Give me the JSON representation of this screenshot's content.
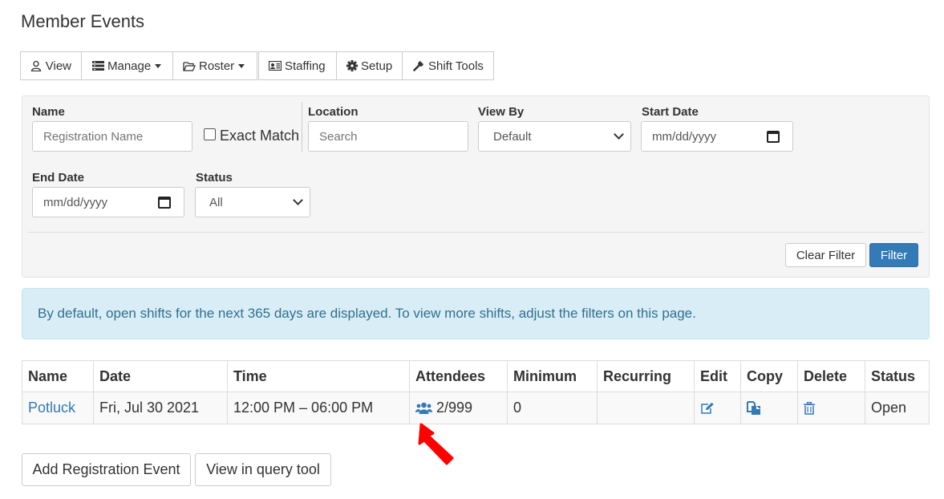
{
  "page": {
    "title": "Member Events"
  },
  "toolbar": {
    "view": "View",
    "manage": "Manage",
    "roster": "Roster",
    "staffing": "Staffing",
    "setup": "Setup",
    "shift_tools": "Shift Tools"
  },
  "filters": {
    "name_label": "Name",
    "name_placeholder": "Registration Name",
    "exact_match_label": "Exact Match",
    "location_label": "Location",
    "location_placeholder": "Search",
    "view_by_label": "View By",
    "view_by_value": "Default",
    "start_date_label": "Start Date",
    "start_date_value": "mm/dd/yyyy",
    "end_date_label": "End Date",
    "end_date_value": "mm/dd/yyyy",
    "status_label": "Status",
    "status_value": "All",
    "clear_button": "Clear Filter",
    "filter_button": "Filter"
  },
  "alert": {
    "text": "By default, open shifts for the next 365 days are displayed. To view more shifts, adjust the filters on this page."
  },
  "table": {
    "headers": {
      "name": "Name",
      "date": "Date",
      "time": "Time",
      "attendees": "Attendees",
      "minimum": "Minimum",
      "recurring": "Recurring",
      "edit": "Edit",
      "copy": "Copy",
      "delete": "Delete",
      "status": "Status"
    },
    "rows": [
      {
        "name": "Potluck",
        "date": "Fri, Jul 30 2021",
        "time": "12:00 PM – 06:00 PM",
        "attendees": "2/999",
        "minimum": "0",
        "recurring": "",
        "status": "Open"
      }
    ]
  },
  "actions": {
    "add_event": "Add Registration Event",
    "query_tool": "View in query tool"
  },
  "colors": {
    "primary": "#337ab7",
    "alert_bg": "#d9edf7",
    "annotation": "#ff0000"
  }
}
